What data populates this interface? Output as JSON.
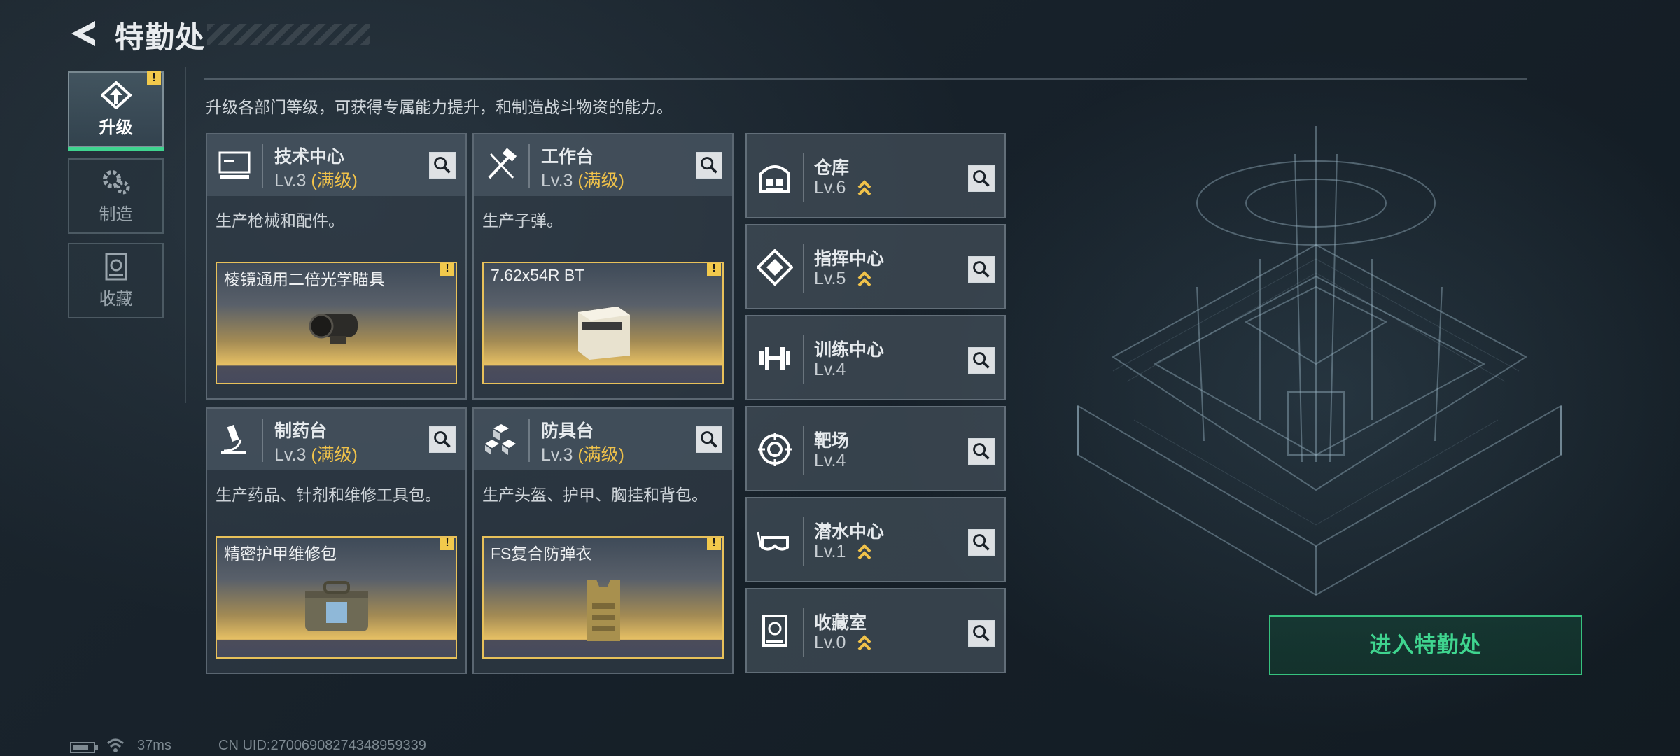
{
  "header": {
    "title": "特勤处"
  },
  "tabs": [
    {
      "label": "升级",
      "icon": "upgrade-icon",
      "active": true,
      "warning": "!"
    },
    {
      "label": "制造",
      "icon": "gears-icon",
      "active": false
    },
    {
      "label": "收藏",
      "icon": "collection-icon",
      "active": false
    }
  ],
  "description": "升级各部门等级，可获得专属能力提升，和制造战斗物资的能力。",
  "departments_main": [
    {
      "name": "技术中心",
      "level": "Lv.3",
      "max_label": "(满级)",
      "desc": "生产枪械和配件。",
      "item": "棱镜通用二倍光学瞄具",
      "warning": "!"
    },
    {
      "name": "工作台",
      "level": "Lv.3",
      "max_label": "(满级)",
      "desc": "生产子弹。",
      "item": "7.62x54R BT",
      "warning": "!"
    },
    {
      "name": "制药台",
      "level": "Lv.3",
      "max_label": "(满级)",
      "desc": "生产药品、针剂和维修工具包。",
      "item": "精密护甲维修包",
      "warning": "!"
    },
    {
      "name": "防具台",
      "level": "Lv.3",
      "max_label": "(满级)",
      "desc": "生产头盔、护甲、胸挂和背包。",
      "item": "FS复合防弹衣",
      "warning": "!"
    }
  ],
  "departments_list": [
    {
      "name": "仓库",
      "level": "Lv.6",
      "upgradable": true
    },
    {
      "name": "指挥中心",
      "level": "Lv.5",
      "upgradable": true
    },
    {
      "name": "训练中心",
      "level": "Lv.4",
      "upgradable": false
    },
    {
      "name": "靶场",
      "level": "Lv.4",
      "upgradable": false
    },
    {
      "name": "潜水中心",
      "level": "Lv.1",
      "upgradable": true
    },
    {
      "name": "收藏室",
      "level": "Lv.0",
      "upgradable": true
    }
  ],
  "enter_button": "进入特勤处",
  "status_bar": {
    "ping": "37ms",
    "uid": "CN UID:27006908274348959339"
  },
  "colors": {
    "accent_green": "#3fd48f",
    "max_level_gold": "#f0c24a",
    "warning_yellow": "#f2c94c"
  }
}
